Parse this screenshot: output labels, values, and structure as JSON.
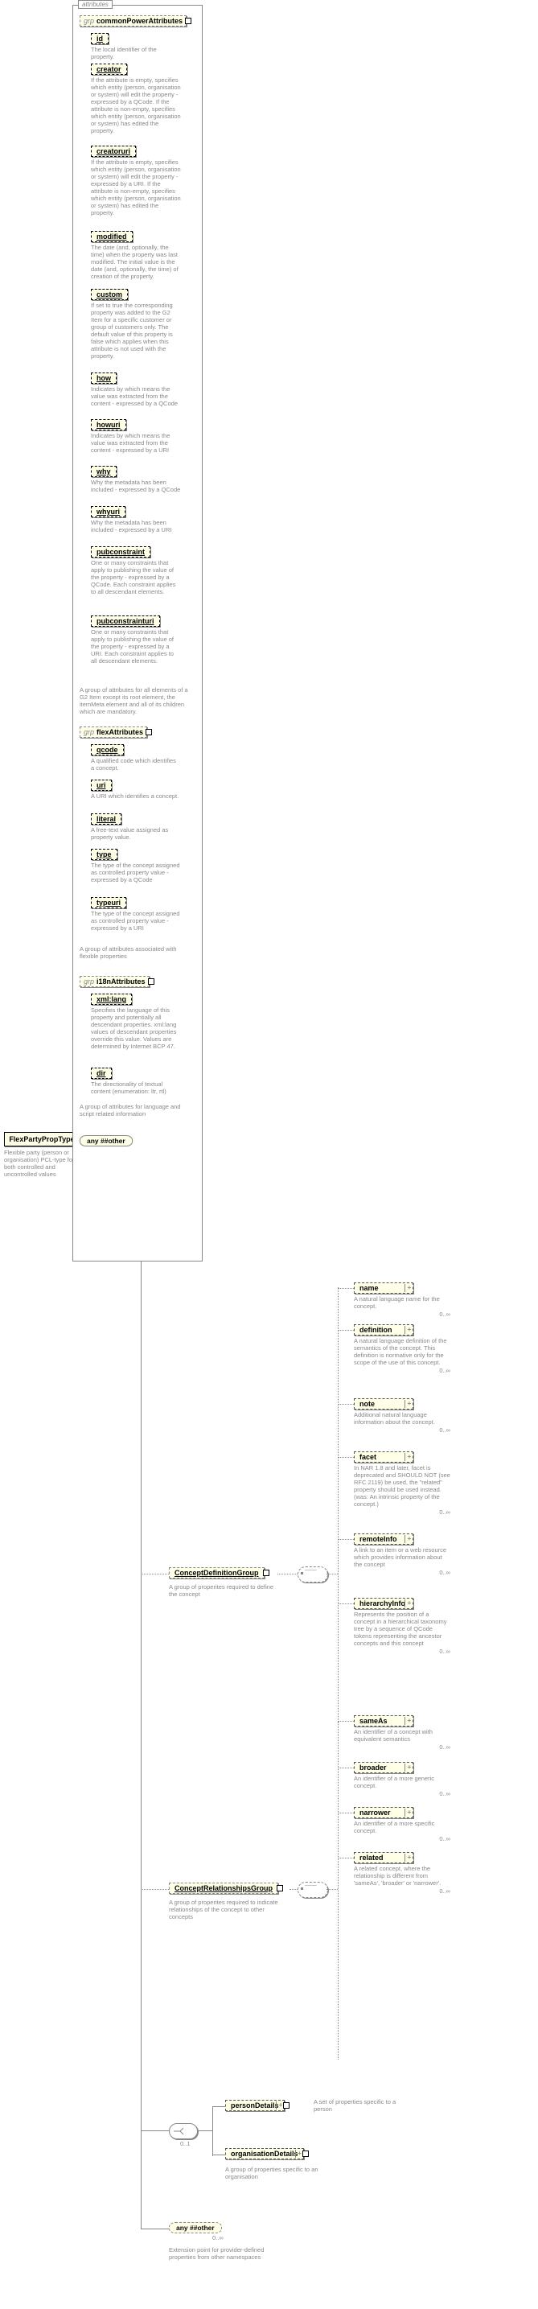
{
  "root": {
    "name": "FlexPartyPropType",
    "desc": "Flexible party (person or organisation) PCL-type for both controlled and uncontrolled values"
  },
  "seq_card": "0..∞",
  "groups": {
    "attributes_label": "attributes",
    "common": {
      "label": "grp",
      "name": "commonPowerAttributes",
      "desc": "A group of attributes for all elements of a G2 Item except its root element, the itemMeta element and all of its children which are mandatory.",
      "items": [
        {
          "name": "id",
          "desc": "The local identifier of the property."
        },
        {
          "name": "creator",
          "desc": "If the attribute is empty, specifies which entity (person, organisation or system) will edit the property - expressed by a QCode. If the attribute is non-empty, specifies which entity (person, organisation or system) has edited the property."
        },
        {
          "name": "creatoruri",
          "desc": "If the attribute is empty, specifies which entity (person, organisation or system) will edit the property - expressed by a URI. If the attribute is non-empty, specifies which entity (person, organisation or system) has edited the property."
        },
        {
          "name": "modified",
          "desc": "The date (and, optionally, the time) when the property was last modified. The initial value is the date (and, optionally, the time) of creation of the property."
        },
        {
          "name": "custom",
          "desc": "If set to true the corresponding property was added to the G2 Item for a specific customer or group of customers only. The default value of this property is false which applies when this attribute is not used with the property."
        },
        {
          "name": "how",
          "desc": "Indicates by which means the value was extracted from the content - expressed by a QCode"
        },
        {
          "name": "howuri",
          "desc": "Indicates by which means the value was extracted from the content - expressed by a URI"
        },
        {
          "name": "why",
          "desc": "Why the metadata has been included - expressed by a QCode"
        },
        {
          "name": "whyuri",
          "desc": "Why the metadata has been included - expressed by a URI"
        },
        {
          "name": "pubconstraint",
          "desc": "One or many constraints that apply to publishing the value of the property - expressed by a QCode. Each constraint applies to all descendant elements."
        },
        {
          "name": "pubconstrainturi",
          "desc": "One or many constraints that apply to publishing the value of the property - expressed by a URI. Each constraint applies to all descendant elements."
        }
      ]
    },
    "flex": {
      "label": "grp",
      "name": "flexAttributes",
      "desc": "A group of attributes associated with flexible properties",
      "items": [
        {
          "name": "qcode",
          "desc": "A qualified code which identifies a concept."
        },
        {
          "name": "uri",
          "desc": "A URI which identifies a concept."
        },
        {
          "name": "literal",
          "desc": "A free-text value assigned as property value."
        },
        {
          "name": "type",
          "desc": "The type of the concept assigned as controlled property value - expressed by a QCode"
        },
        {
          "name": "typeuri",
          "desc": "The type of the concept assigned as controlled property value - expressed by a URI"
        }
      ]
    },
    "i18n": {
      "label": "grp",
      "name": "i18nAttributes",
      "desc": "A group of attributes for language and script related information",
      "items": [
        {
          "name": "xml:lang",
          "desc": "Specifies the language of this property and potentially all descendant properties. xml:lang values of descendant properties override this value. Values are determined by Internet BCP 47."
        },
        {
          "name": "dir",
          "desc": "The directionality of textual content (enumeration: ltr, rtl)"
        }
      ]
    },
    "any_label": "any ##other"
  },
  "model_groups": {
    "def": {
      "name": "ConceptDefinitionGroup",
      "desc": "A group of properites required to define the concept",
      "items": [
        {
          "name": "name",
          "desc": "A natural language name for the concept."
        },
        {
          "name": "definition",
          "desc": "A natural language definition of the semantics of the concept. This definition is normative only for the scope of the use of this concept."
        },
        {
          "name": "note",
          "desc": "Additional natural language information about the concept."
        },
        {
          "name": "facet",
          "desc": "In NAR 1.8 and later, facet is deprecated and SHOULD NOT (see RFC 2119) be used, the \"related\" property should be used instead. (was: An intrinsic property of the concept.)"
        },
        {
          "name": "remoteInfo",
          "desc": "A link to an item or a web resource which provides information about the concept"
        },
        {
          "name": "hierarchyInfo",
          "desc": "Represents the position of a concept in a hierarchical taxonomy tree by a sequence of QCode tokens representing the ancestor concepts and this concept"
        }
      ]
    },
    "rel": {
      "name": "ConceptRelationshipsGroup",
      "desc": "A group of properites required to indicate relationships of the concept to other concepts",
      "items": [
        {
          "name": "sameAs",
          "desc": "An identifier of a concept with equivalent semantics"
        },
        {
          "name": "broader",
          "desc": "An identifier of a more generic concept."
        },
        {
          "name": "narrower",
          "desc": "An identifier of a more specific concept."
        },
        {
          "name": "related",
          "desc": "A related concept, where the relationship is different from 'sameAs', 'broader' or 'narrower'."
        }
      ]
    }
  },
  "person_org": {
    "person": {
      "name": "personDetails",
      "desc": "A set of properties specific to a person"
    },
    "org": {
      "name": "organisationDetails",
      "desc": "A group of properties specific to an organisation"
    }
  },
  "ext": {
    "name": "any ##other",
    "desc": "Extension point for provider-defined properties from other namespaces"
  }
}
